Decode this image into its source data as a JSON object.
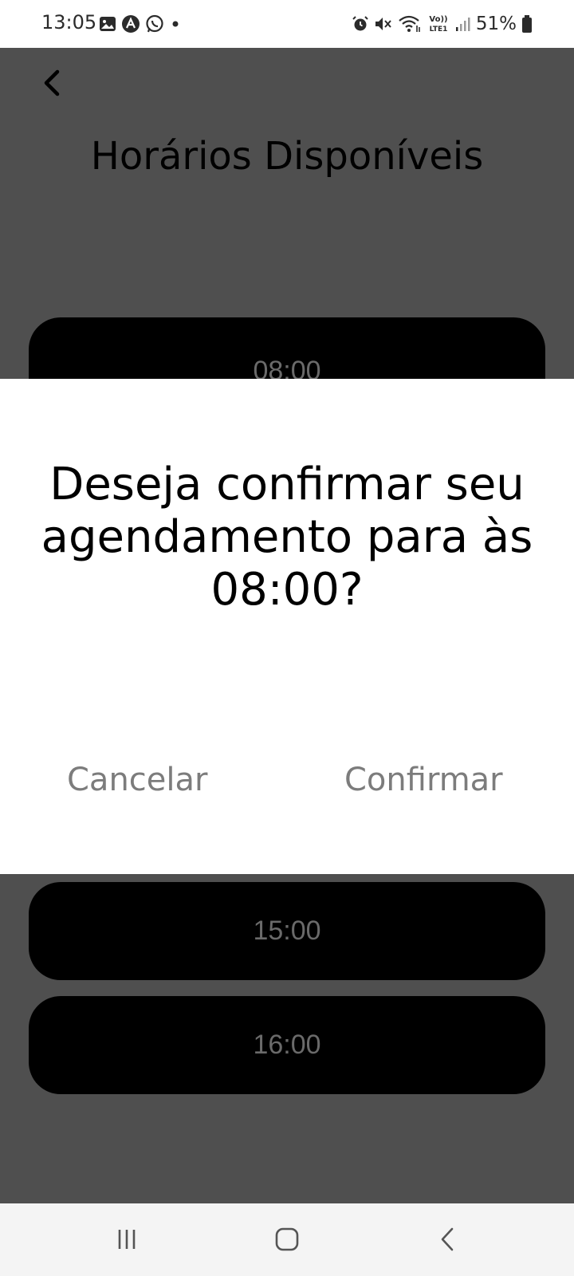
{
  "status_bar": {
    "time": "13:05",
    "battery_percent": "51%",
    "left_icons": [
      "gallery-icon",
      "app-icon",
      "whatsapp-icon",
      "dot-icon"
    ],
    "right_icons": [
      "alarm-icon",
      "mute-icon",
      "wifi-icon",
      "volte-icon",
      "signal-icon",
      "battery-icon"
    ]
  },
  "header": {
    "back_icon": "chevron-left-icon",
    "title": "Horários Disponíveis"
  },
  "slots": [
    {
      "label": "08:00"
    },
    {
      "label": "15:00"
    },
    {
      "label": "16:00"
    }
  ],
  "dialog": {
    "message": "Deseja confirmar seu agendamento para às 08:00?",
    "cancel_label": "Cancelar",
    "confirm_label": "Confirmar"
  },
  "nav_bar": {
    "items": [
      "recent-apps-icon",
      "home-icon",
      "back-icon"
    ]
  },
  "colors": {
    "overlay": "#4f4f4f",
    "slot_bg": "#000000",
    "dialog_bg": "#ffffff",
    "button_text": "#7c7c7c"
  }
}
